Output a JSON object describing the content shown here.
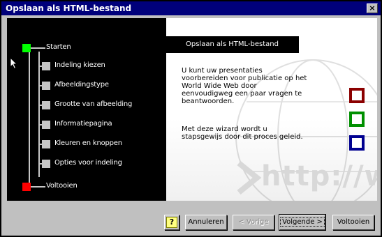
{
  "window": {
    "title": "Opslaan als HTML-bestand",
    "close_label": "×"
  },
  "steps": [
    {
      "label": "Starten",
      "state": "green"
    },
    {
      "label": "Indeling kiezen",
      "state": "grey"
    },
    {
      "label": "Afbeeldingstype",
      "state": "grey"
    },
    {
      "label": "Grootte van afbeelding",
      "state": "grey"
    },
    {
      "label": "Informatiepagina",
      "state": "grey"
    },
    {
      "label": "Kleuren en knoppen",
      "state": "grey"
    },
    {
      "label": "Opties voor indeling",
      "state": "grey"
    },
    {
      "label": "Voltooien",
      "state": "red"
    }
  ],
  "panel": {
    "title": "Opslaan als HTML-bestand",
    "text1": "U kunt uw presentaties\nvoorbereiden voor publicatie op het\nWorld Wide Web door\neenvoudigweg een paar vragen te\nbeantwoorden.",
    "text2": "Met deze wizard wordt u\nstapsgewijs door dit proces geleid.",
    "watermark_text": "http://w"
  },
  "buttons": {
    "help": "?",
    "cancel": "Annuleren",
    "back": "< Vorige",
    "next": "Volgende >",
    "finish": "Voltooien"
  },
  "colors": {
    "titlebar": "#00007b",
    "step_start": "#00ff00",
    "step_finish": "#ff0000",
    "square_brown": "#8b0000",
    "square_green": "#009000",
    "square_blue": "#000090"
  }
}
